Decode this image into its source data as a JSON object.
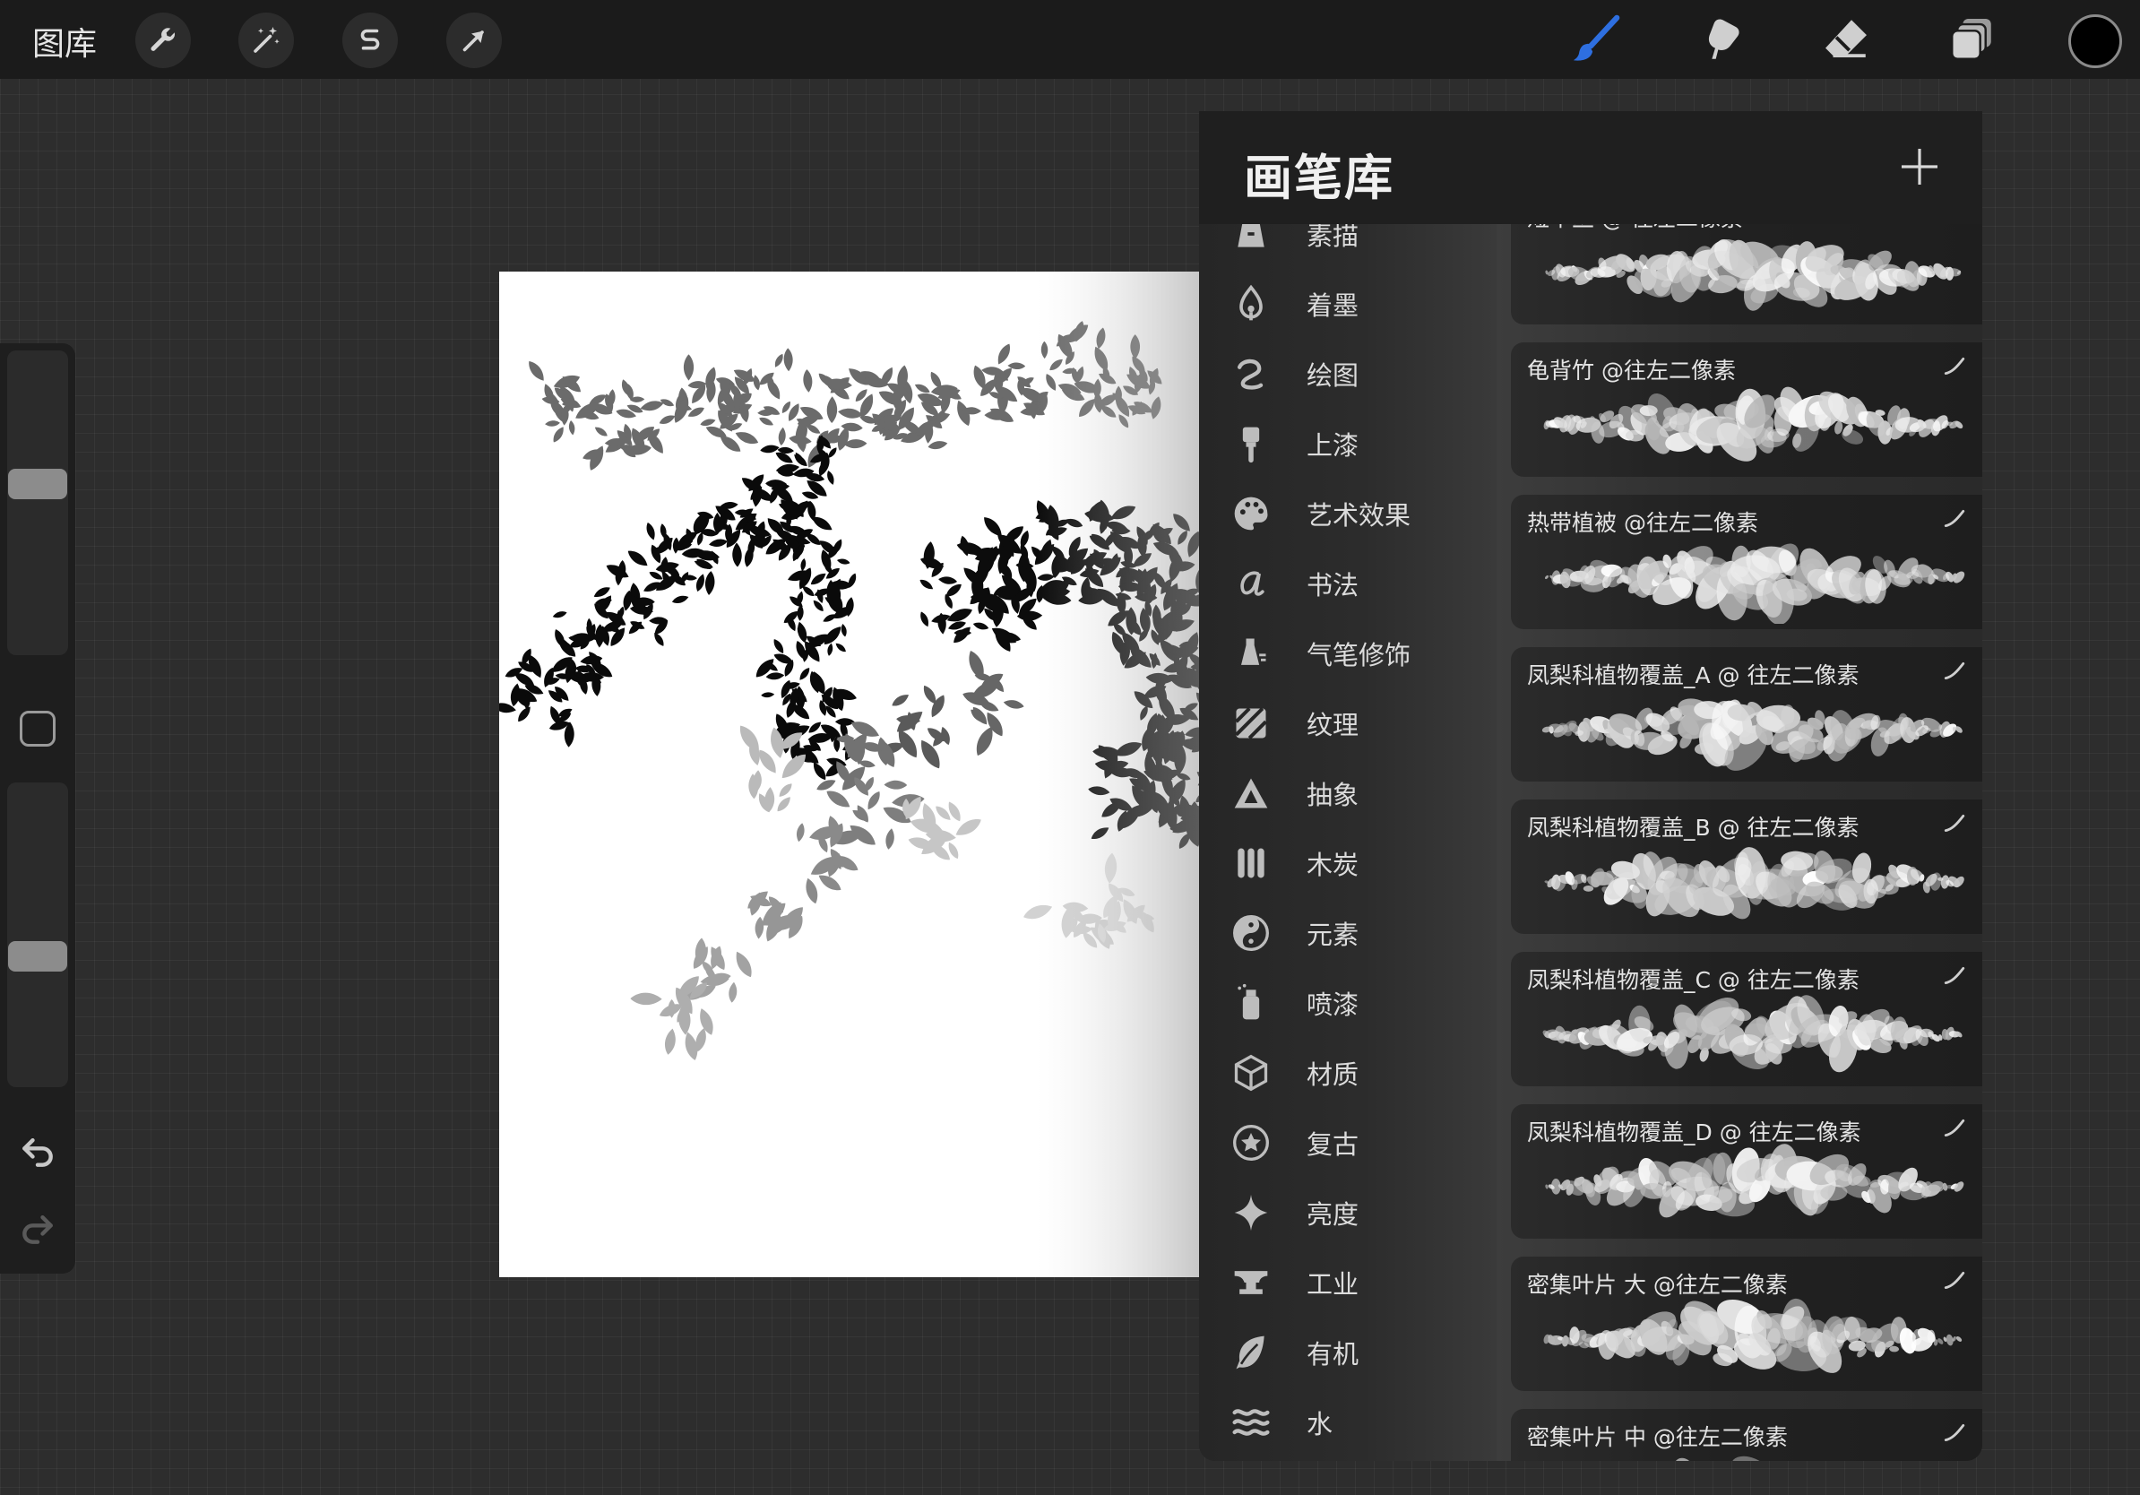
{
  "toolbar": {
    "gallery_label": "图库",
    "left_tools": [
      "wrench-icon",
      "magic-wand-icon",
      "selection-s-icon",
      "transform-arrow-icon"
    ],
    "right_tools": [
      "brush-icon",
      "smudge-icon",
      "eraser-icon",
      "layers-icon"
    ],
    "active_tool": "brush-icon",
    "active_color": "#2e6fe0",
    "current_color": "#000000"
  },
  "sidebar": {
    "size_slider_level": 0.57,
    "opacity_slider_level": 0.42
  },
  "brush_library": {
    "title": "画笔库",
    "categories": [
      {
        "label": "素描",
        "icon": "sketch-icon"
      },
      {
        "label": "着墨",
        "icon": "ink-pen-icon"
      },
      {
        "label": "绘图",
        "icon": "drawing-curl-icon"
      },
      {
        "label": "上漆",
        "icon": "paint-brush-icon"
      },
      {
        "label": "艺术效果",
        "icon": "palette-icon"
      },
      {
        "label": "书法",
        "icon": "calligraphy-a-icon"
      },
      {
        "label": "气笔修饰",
        "icon": "airbrush-icon"
      },
      {
        "label": "纹理",
        "icon": "texture-stripes-icon"
      },
      {
        "label": "抽象",
        "icon": "triangle-icon"
      },
      {
        "label": "木炭",
        "icon": "charcoal-sticks-icon"
      },
      {
        "label": "元素",
        "icon": "yin-yang-icon"
      },
      {
        "label": "喷漆",
        "icon": "spray-can-icon"
      },
      {
        "label": "材质",
        "icon": "cube-icon"
      },
      {
        "label": "复古",
        "icon": "star-badge-icon"
      },
      {
        "label": "亮度",
        "icon": "sparkle-icon"
      },
      {
        "label": "工业",
        "icon": "anvil-icon"
      },
      {
        "label": "有机",
        "icon": "leaf-icon"
      },
      {
        "label": "水",
        "icon": "waves-icon"
      }
    ],
    "brushes": [
      {
        "name": "短草丛 @ 往左二像素"
      },
      {
        "name": "龟背竹 @往左二像素"
      },
      {
        "name": "热带植被 @往左二像素"
      },
      {
        "name": "凤梨科植物覆盖_A @ 往左二像素"
      },
      {
        "name": "凤梨科植物覆盖_B @ 往左二像素"
      },
      {
        "name": "凤梨科植物覆盖_C @ 往左二像素"
      },
      {
        "name": "凤梨科植物覆盖_D @ 往左二像素"
      },
      {
        "name": "密集叶片 大 @往左二像素"
      },
      {
        "name": "密集叶片 中 @往左二像素"
      }
    ]
  }
}
